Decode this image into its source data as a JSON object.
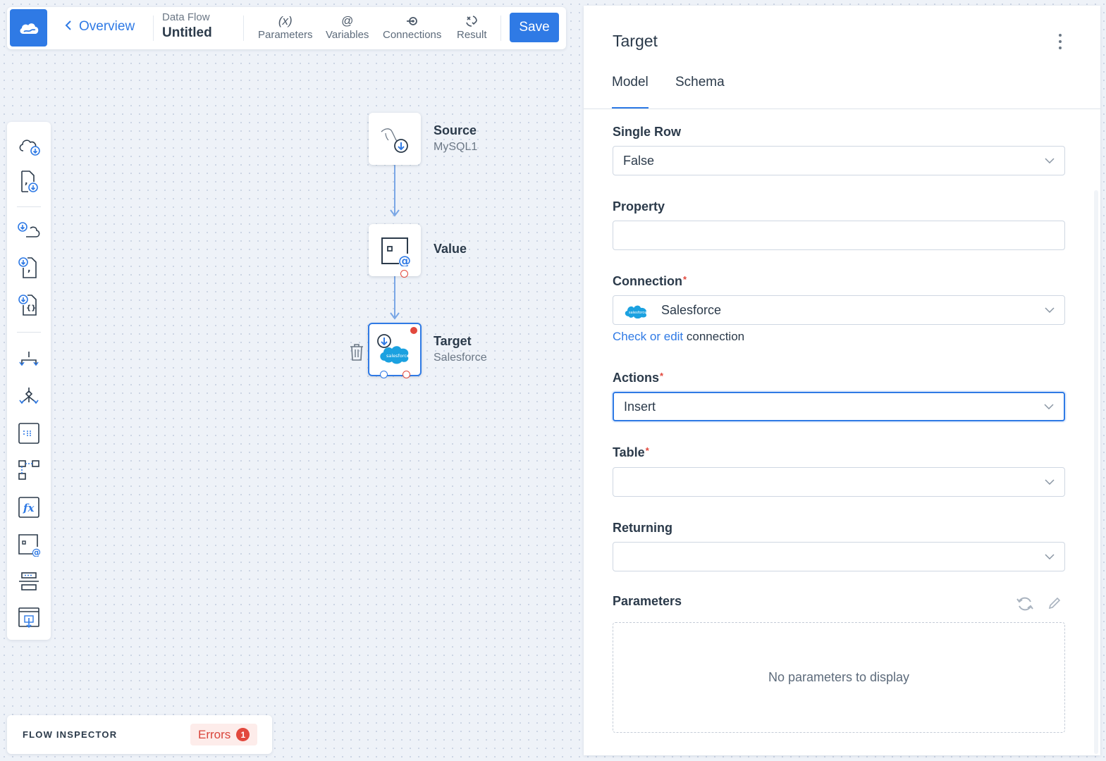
{
  "header": {
    "back_label": "Overview",
    "flow_type_label": "Data Flow",
    "flow_name": "Untitled",
    "tools": [
      {
        "label": "Parameters",
        "icon": "parameters-icon",
        "glyph": "(x)"
      },
      {
        "label": "Variables",
        "icon": "variables-icon",
        "glyph": "@"
      },
      {
        "label": "Connections",
        "icon": "connections-icon"
      },
      {
        "label": "Result",
        "icon": "result-icon"
      }
    ],
    "save_label": "Save"
  },
  "palette": {
    "items": [
      "cloud-source-icon",
      "file-source-icon",
      "cloud-target-icon",
      "csv-target-icon",
      "json-target-icon",
      "split-icon",
      "merge-icon",
      "buffer-icon",
      "lookup-icon",
      "expression-icon",
      "value-icon",
      "row-count-icon",
      "import-icon"
    ]
  },
  "nodes": {
    "source": {
      "title": "Source",
      "subtitle": "MySQL1"
    },
    "value": {
      "title": "Value"
    },
    "target": {
      "title": "Target",
      "subtitle": "Salesforce",
      "logo_text": "salesforce"
    }
  },
  "inspector": {
    "label": "FLOW INSPECTOR",
    "errors_label": "Errors",
    "errors_count": "1"
  },
  "panel": {
    "title": "Target",
    "tabs": [
      {
        "label": "Model",
        "active": true
      },
      {
        "label": "Schema",
        "active": false
      }
    ],
    "fields": {
      "single_row": {
        "label": "Single Row",
        "value": "False"
      },
      "property": {
        "label": "Property",
        "value": ""
      },
      "connection": {
        "label": "Connection",
        "required": "*",
        "value": "Salesforce",
        "logo_text": "salesforce"
      },
      "actions": {
        "label": "Actions",
        "required": "*",
        "value": "Insert"
      },
      "table": {
        "label": "Table",
        "required": "*",
        "value": ""
      },
      "returning": {
        "label": "Returning",
        "value": ""
      },
      "parameters": {
        "label": "Parameters",
        "empty_text": "No parameters to display"
      }
    },
    "connection_link": {
      "link_text": "Check or edit",
      "rest_text": " connection"
    }
  },
  "colors": {
    "accent": "#2f7ae5",
    "error": "#e2483d",
    "salesforce": "#1ba1e0"
  }
}
